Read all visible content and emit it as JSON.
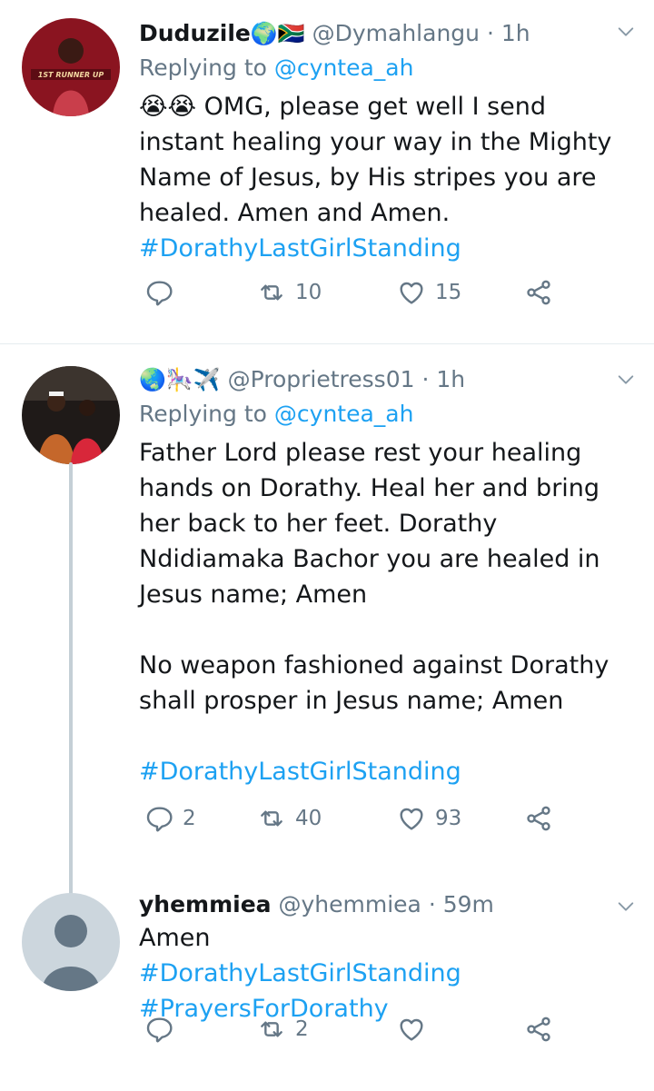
{
  "tweets": [
    {
      "name": "Duduzile",
      "name_emoji": "🌍🇿🇦",
      "handle": "@Dymahlangu",
      "time": "1h",
      "replying_label": "Replying to",
      "replying_handle": "@cyntea_ah",
      "body_lines": [
        "😭😭 OMG, please get well I send instant healing your way in the Mighty Name of Jesus, by His stripes you are healed. Amen and Amen."
      ],
      "hashtags": [
        "#DorathyLastGirlStanding"
      ],
      "avatar_text": "1ST RUNNER UP",
      "replies": "",
      "retweets": "10",
      "likes": "15"
    },
    {
      "name_emoji": "🌏🎠✈️",
      "handle": "@Proprietress01",
      "time": "1h",
      "replying_label": "Replying to",
      "replying_handle": "@cyntea_ah",
      "body_lines": [
        "Father Lord please rest your healing hands on Dorathy. Heal her and bring her back to her feet. Dorathy Ndidiamaka Bachor you are healed in Jesus name; Amen",
        "No weapon fashioned against Dorathy shall prosper in Jesus name; Amen"
      ],
      "hashtags": [
        "#DorathyLastGirlStanding"
      ],
      "replies": "2",
      "retweets": "40",
      "likes": "93"
    },
    {
      "name": "yhemmiea",
      "handle": "@yhemmiea",
      "time": "59m",
      "body_lines": [
        "Amen"
      ],
      "hashtags": [
        "#DorathyLastGirlStanding",
        "#PrayersForDorathy"
      ],
      "replies": "",
      "retweets": "2",
      "likes": ""
    }
  ],
  "separator": "·",
  "colors": {
    "link": "#1da1f2",
    "muted": "#657786",
    "text": "#14171a",
    "thread_line": "#c4cfd6"
  }
}
